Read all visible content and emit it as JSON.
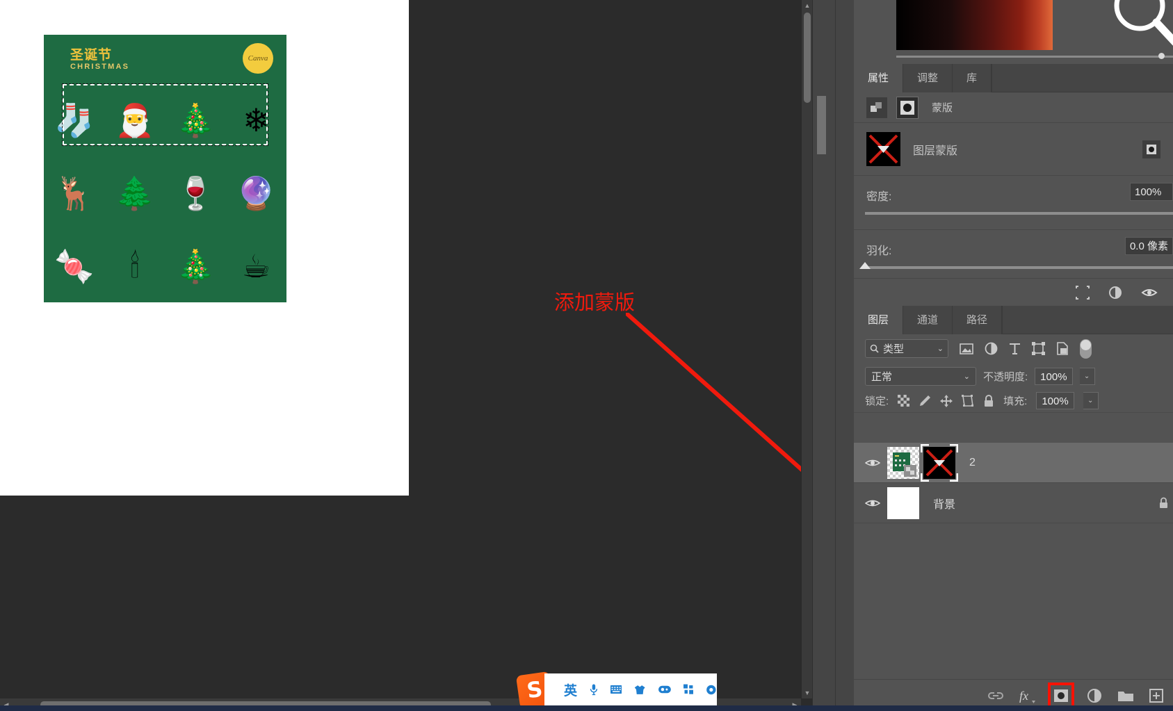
{
  "app": {
    "name": "Adobe Photoshop"
  },
  "canvas": {
    "artwork": {
      "title": "圣诞节",
      "subtitle": "CHRISTMAS",
      "badge": "Canva",
      "background_color": "#1e6b42",
      "title_color": "#f0c33c",
      "rows": [
        {
          "cells": [
            "🧦",
            "🎅",
            "🎄",
            "❄"
          ]
        },
        {
          "cells": [
            "🦌",
            "🌲",
            "🍷",
            "🔮"
          ]
        },
        {
          "cells": [
            "🍬",
            "🕯",
            "🎄",
            "☕"
          ]
        }
      ],
      "selection_marquee": "marching-ants-selection"
    },
    "vertical_scrollbar": {
      "up": "▲",
      "down": "▼"
    },
    "horizontal_scrollbar": {
      "left": "◀",
      "right": "▶"
    }
  },
  "annotation": {
    "text": "添加蒙版",
    "color": "#f01a0d",
    "arrow": "points-to-add-layer-mask-button"
  },
  "properties_panel": {
    "tabs": [
      {
        "label": "属性",
        "active": true
      },
      {
        "label": "调整",
        "active": false
      },
      {
        "label": "库",
        "active": false
      }
    ],
    "header_label": "蒙版",
    "mask_name": "图层蒙版",
    "density": {
      "label": "密度:",
      "value": "100%"
    },
    "feather": {
      "label": "羽化:",
      "value": "0.0 像素"
    },
    "footer_icons": [
      "select-and-mask-icon",
      "invert-mask-icon",
      "toggle-mask-visibility-icon"
    ]
  },
  "layers_panel": {
    "tabs": [
      {
        "label": "图层",
        "active": true
      },
      {
        "label": "通道",
        "active": false
      },
      {
        "label": "路径",
        "active": false
      }
    ],
    "filter": {
      "label": "类型",
      "chevron": "⌄"
    },
    "filter_icons": [
      "pixel-filter-icon",
      "adjustment-filter-icon",
      "type-filter-icon",
      "shape-filter-icon",
      "smart-object-filter-icon"
    ],
    "blend_mode": "正常",
    "opacity": {
      "label": "不透明度:",
      "value": "100%"
    },
    "lock": {
      "label": "锁定:",
      "icons": [
        "lock-transparent-pixels-icon",
        "lock-image-pixels-icon",
        "lock-position-icon",
        "lock-artboard-nesting-icon",
        "lock-all-icon"
      ]
    },
    "fill": {
      "label": "填充:",
      "value": "100%"
    },
    "layers": [
      {
        "name": "2",
        "visible": true,
        "selected": true,
        "has_mask": true,
        "thumb": "christmas-artwork-thumbnail"
      },
      {
        "name": "背景",
        "visible": true,
        "selected": false,
        "has_mask": false,
        "thumb": "white-background-thumbnail"
      }
    ],
    "footer_icons": [
      "link-layers-icon",
      "layer-style-fx-icon",
      "add-layer-mask-icon",
      "new-fill-adjustment-layer-icon",
      "new-group-icon",
      "new-layer-icon"
    ],
    "highlighted_footer_icon": "add-layer-mask-icon"
  },
  "taskbar": {
    "ime_name": "S",
    "items": [
      "英",
      "microphone-icon",
      "keyboard-icon",
      "skin-icon",
      "toolbox-icon",
      "apps-icon",
      "settings-icon"
    ]
  }
}
